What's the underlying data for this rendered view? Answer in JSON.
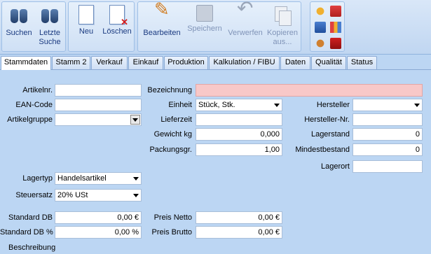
{
  "toolbar": {
    "suchen": "Suchen",
    "letzte_suche_1": "Letzte",
    "letzte_suche_2": "Suche",
    "neu": "Neu",
    "loeschen": "Löschen",
    "bearbeiten": "Bearbeiten",
    "speichern": "Speichern",
    "verwerfen": "Verwerfen",
    "kopieren_1": "Kopieren",
    "kopieren_2": "aus..."
  },
  "tabs": [
    "Stammdaten",
    "Stamm 2",
    "Verkauf",
    "Einkauf",
    "Produktion",
    "Kalkulation / FIBU",
    "Daten",
    "Qualität",
    "Status"
  ],
  "form": {
    "artikelnr_label": "Artikelnr.",
    "artikelnr_value": "",
    "ean_label": "EAN-Code",
    "ean_value": "",
    "artikelgruppe_label": "Artikelgruppe",
    "artikelgruppe_value": "",
    "bezeichnung_label": "Bezeichnung",
    "bezeichnung_value": "",
    "einheit_label": "Einheit",
    "einheit_value": "Stück, Stk.",
    "lieferzeit_label": "Lieferzeit",
    "lieferzeit_value": "",
    "gewicht_label": "Gewicht kg",
    "gewicht_value": "0,000",
    "packungsgr_label": "Packungsgr.",
    "packungsgr_value": "1,00",
    "hersteller_label": "Hersteller",
    "hersteller_value": "",
    "herstellernr_label": "Hersteller-Nr.",
    "herstellernr_value": "",
    "lagerstand_label": "Lagerstand",
    "lagerstand_value": "0",
    "mindestbestand_label": "Mindestbestand",
    "mindestbestand_value": "0",
    "lagerort_label": "Lagerort",
    "lagerort_value": "",
    "lagertyp_label": "Lagertyp",
    "lagertyp_value": "Handelsartikel",
    "steuersatz_label": "Steuersatz",
    "steuersatz_value": "20% USt",
    "standard_db_label": "Standard DB",
    "standard_db_value": "0,00 €",
    "standard_db_pct_label": "Standard DB %",
    "standard_db_pct_value": "0,00 %",
    "preis_netto_label": "Preis Netto",
    "preis_netto_value": "0,00 €",
    "preis_brutto_label": "Preis Brutto",
    "preis_brutto_value": "0,00 €",
    "beschreibung_label": "Beschreibung"
  }
}
